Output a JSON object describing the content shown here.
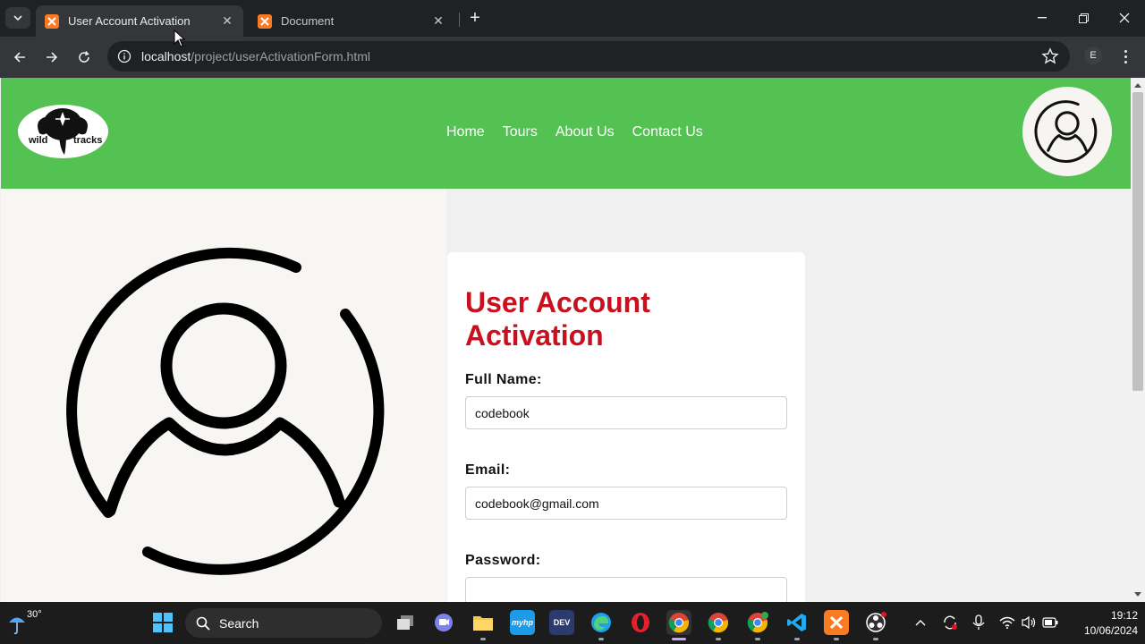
{
  "browser": {
    "tabs": [
      {
        "title": "User Account Activation",
        "active": true
      },
      {
        "title": "Document",
        "active": false
      }
    ],
    "url_host": "localhost",
    "url_path": "/project/userActivationForm.html",
    "profile_initial": "E"
  },
  "site": {
    "logo": {
      "text_left": "wild",
      "text_right": "tracks"
    },
    "nav": [
      "Home",
      "Tours",
      "About Us",
      "Contact Us"
    ]
  },
  "form": {
    "title_line1": "User Account",
    "title_line2": "Activation",
    "fields": [
      {
        "label": "Full Name:",
        "value": "codebook",
        "placeholder": ""
      },
      {
        "label": "Email:",
        "value": "codebook@gmail.com",
        "placeholder": ""
      },
      {
        "label": "Password:",
        "value": "",
        "placeholder": ""
      }
    ]
  },
  "taskbar": {
    "weather_temp": "30°",
    "search_placeholder": "Search",
    "time": "19:12",
    "date": "10/06/2024",
    "apps": [
      "start-icon",
      "task-view-icon",
      "teams-icon",
      "file-explorer-icon",
      "myhp-icon",
      "dev-home-icon",
      "edge-icon",
      "opera-icon",
      "chrome-icon",
      "chrome-profile-icon",
      "chrome-badge-icon",
      "vscode-icon",
      "xampp-icon",
      "obs-icon"
    ],
    "app_labels": {
      "myhp": "myhp",
      "dev": "DEV"
    }
  },
  "colors": {
    "header_green": "#54c253",
    "title_red": "#c8101e",
    "chrome_dark": "#202124"
  }
}
